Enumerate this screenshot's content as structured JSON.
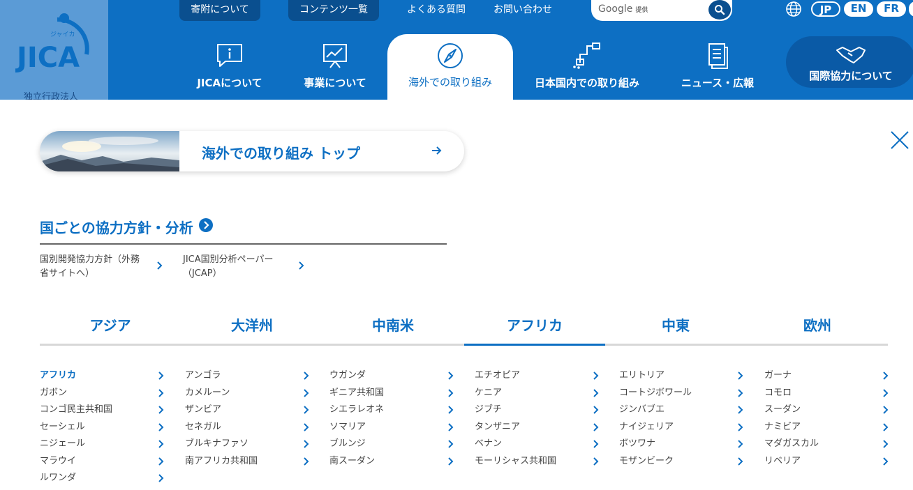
{
  "header": {
    "logo_text": "JICA",
    "logo_kana": "ジャイカ",
    "logo_sub": "独立行政法人",
    "top_links": [
      "寄附について",
      "コンテンツ一覧",
      "よくある質問",
      "お問い合わせ"
    ],
    "search": {
      "provider": "Google",
      "provider_suffix": "提供",
      "placeholder": ""
    },
    "languages": [
      "JP",
      "EN",
      "FR"
    ],
    "nav": [
      {
        "label": "JICAについて",
        "icon": "info-icon"
      },
      {
        "label": "事業について",
        "icon": "presentation-icon"
      },
      {
        "label": "海外での取り組み",
        "icon": "compass-icon"
      },
      {
        "label": "日本国内での取り組み",
        "icon": "route-icon"
      },
      {
        "label": "ニュース・広報",
        "icon": "document-icon"
      },
      {
        "label": "国際協力について",
        "icon": "handshake-icon"
      }
    ]
  },
  "top_link": {
    "label": "海外での取り組み トップ"
  },
  "policy": {
    "heading": "国ごとの協力方針・分析",
    "links": [
      {
        "line1": "国別開発協力方針（外務",
        "line2": "省サイトへ）"
      },
      {
        "line1": "JICA国別分析ペーパー",
        "line2": "（JCAP）"
      }
    ]
  },
  "regions": [
    "アジア",
    "大洋州",
    "中南米",
    "アフリカ",
    "中東",
    "欧州"
  ],
  "active_region": "アフリカ",
  "countries": [
    [
      "アフリカ",
      "アンゴラ",
      "ウガンダ",
      "エチオピア",
      "エリトリア",
      "ガーナ"
    ],
    [
      "ガボン",
      "カメルーン",
      "ギニア共和国",
      "ケニア",
      "コートジボワール",
      "コモロ"
    ],
    [
      "コンゴ民主共和国",
      "ザンビア",
      "シエラレオネ",
      "ジブチ",
      "ジンバブエ",
      "スーダン"
    ],
    [
      "セーシェル",
      "セネガル",
      "ソマリア",
      "タンザニア",
      "ナイジェリア",
      "ナミビア"
    ],
    [
      "ニジェール",
      "ブルキナファソ",
      "ブルンジ",
      "ベナン",
      "ボツワナ",
      "マダガスカル"
    ],
    [
      "マラウイ",
      "南アフリカ共和国",
      "南スーダン",
      "モーリシャス共和国",
      "モザンビーク",
      "リベリア"
    ],
    [
      "ルワンダ"
    ]
  ],
  "colors": {
    "brand": "#0d6fc3",
    "header_bg": "#0d6fc3",
    "logo_bg": "#5b9bd6"
  }
}
